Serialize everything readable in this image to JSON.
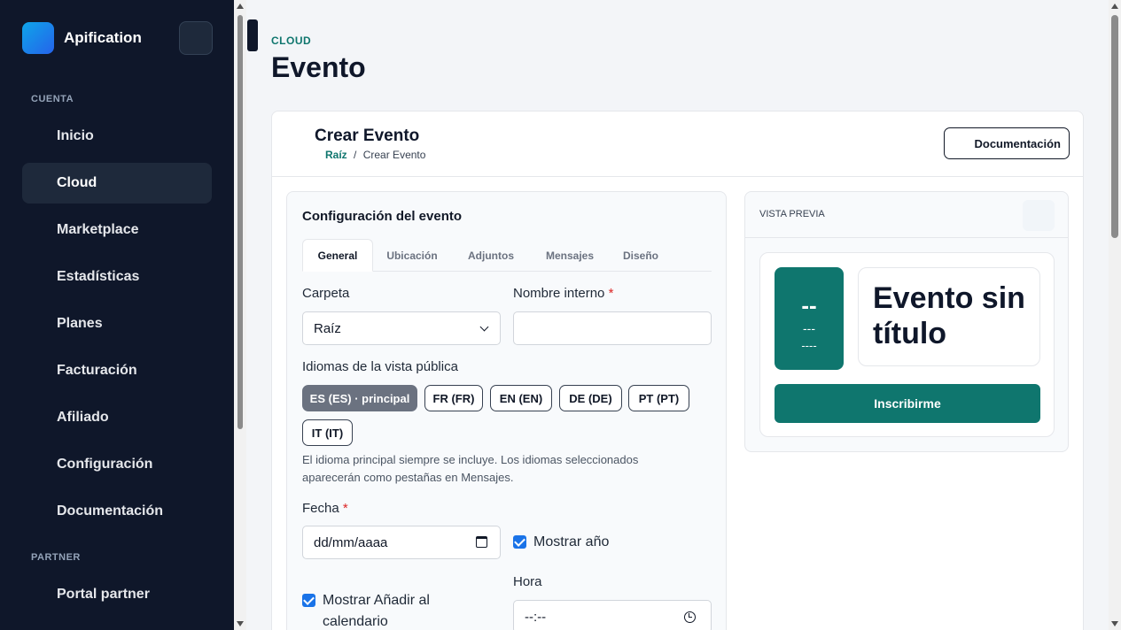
{
  "app": {
    "name": "Apification"
  },
  "sidebar": {
    "sections": [
      {
        "label": "CUENTA"
      },
      {
        "label": "PARTNER"
      }
    ],
    "items": [
      {
        "label": "Inicio"
      },
      {
        "label": "Cloud",
        "active": true
      },
      {
        "label": "Marketplace"
      },
      {
        "label": "Estadísticas"
      },
      {
        "label": "Planes"
      },
      {
        "label": "Facturación"
      },
      {
        "label": "Afiliado"
      },
      {
        "label": "Configuración"
      },
      {
        "label": "Documentación"
      }
    ],
    "partner_items": [
      {
        "label": "Portal partner"
      }
    ]
  },
  "header": {
    "category": "CLOUD",
    "title": "Evento"
  },
  "card": {
    "title": "Crear Evento",
    "breadcrumb": {
      "root": "Raíz",
      "separator": "/",
      "current": "Crear Evento"
    },
    "doc_button": "Documentación"
  },
  "config": {
    "title": "Configuración del evento",
    "tabs": [
      {
        "label": "General",
        "active": true
      },
      {
        "label": "Ubicación"
      },
      {
        "label": "Adjuntos"
      },
      {
        "label": "Mensajes"
      },
      {
        "label": "Diseño"
      }
    ],
    "folder": {
      "label": "Carpeta",
      "value": "Raíz"
    },
    "internal_name": {
      "label": "Nombre interno",
      "required": "*",
      "value": ""
    },
    "languages": {
      "label": "Idiomas de la vista pública",
      "chips": [
        {
          "label": "ES (ES) · principal",
          "primary": true
        },
        {
          "label": "FR (FR)"
        },
        {
          "label": "EN (EN)"
        },
        {
          "label": "DE (DE)"
        },
        {
          "label": "PT (PT)"
        },
        {
          "label": "IT (IT)"
        }
      ],
      "help_line1": "El idioma principal siempre se incluye. Los idiomas seleccionados",
      "help_line2": "aparecerán como pestañas en Mensajes."
    },
    "date": {
      "label": "Fecha",
      "required": "*",
      "placeholder": "dd/mm/aaaa"
    },
    "show_year": {
      "label": "Mostrar año",
      "checked": true
    },
    "add_to_calendar": {
      "label_line1": "Mostrar Añadir al",
      "label_line2": "calendario",
      "checked": true
    },
    "time": {
      "label": "Hora",
      "placeholder": "--:--"
    }
  },
  "preview": {
    "label": "VISTA PREVIA",
    "date_day": "--",
    "date_month": "---",
    "date_year": "----",
    "event_title_line1": "Evento sin",
    "event_title_line2": "título",
    "register_button": "Inscribirme"
  },
  "colors": {
    "sidebar_bg": "#0f172a",
    "accent": "#0f766e",
    "checkbox": "#1a73e8",
    "required": "#dc2626"
  }
}
